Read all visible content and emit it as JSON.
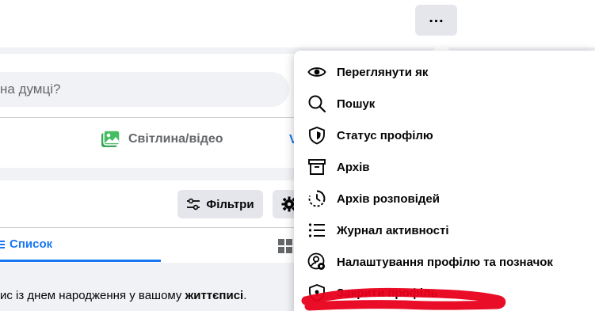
{
  "header": {
    "more_label": "…"
  },
  "composer": {
    "placeholder_text": "на думці?",
    "photo_label": "Світлина/відео",
    "feeling_stub": "V"
  },
  "posts": {
    "filters_label": "Фільтри",
    "list_tab_label": "Список",
    "birthday_prefix": "ис із днем народження у вашому ",
    "birthday_bold": "життєписі",
    "birthday_suffix": "."
  },
  "menu": {
    "items": [
      {
        "label": "Переглянути як",
        "icon": "eye-icon"
      },
      {
        "label": "Пошук",
        "icon": "search-icon"
      },
      {
        "label": "Статус профілю",
        "icon": "shield-icon"
      },
      {
        "label": "Архів",
        "icon": "archive-icon"
      },
      {
        "label": "Архів розповідей",
        "icon": "story-archive-icon"
      },
      {
        "label": "Журнал активності",
        "icon": "activity-log-icon"
      },
      {
        "label": "Налаштування профілю та позначок",
        "icon": "profile-settings-icon"
      },
      {
        "label": "Закрити профіль",
        "icon": "lock-profile-icon"
      }
    ]
  },
  "colors": {
    "accent": "#1877f2",
    "annotation": "#e8001c",
    "photo_green": "#45bd62"
  }
}
